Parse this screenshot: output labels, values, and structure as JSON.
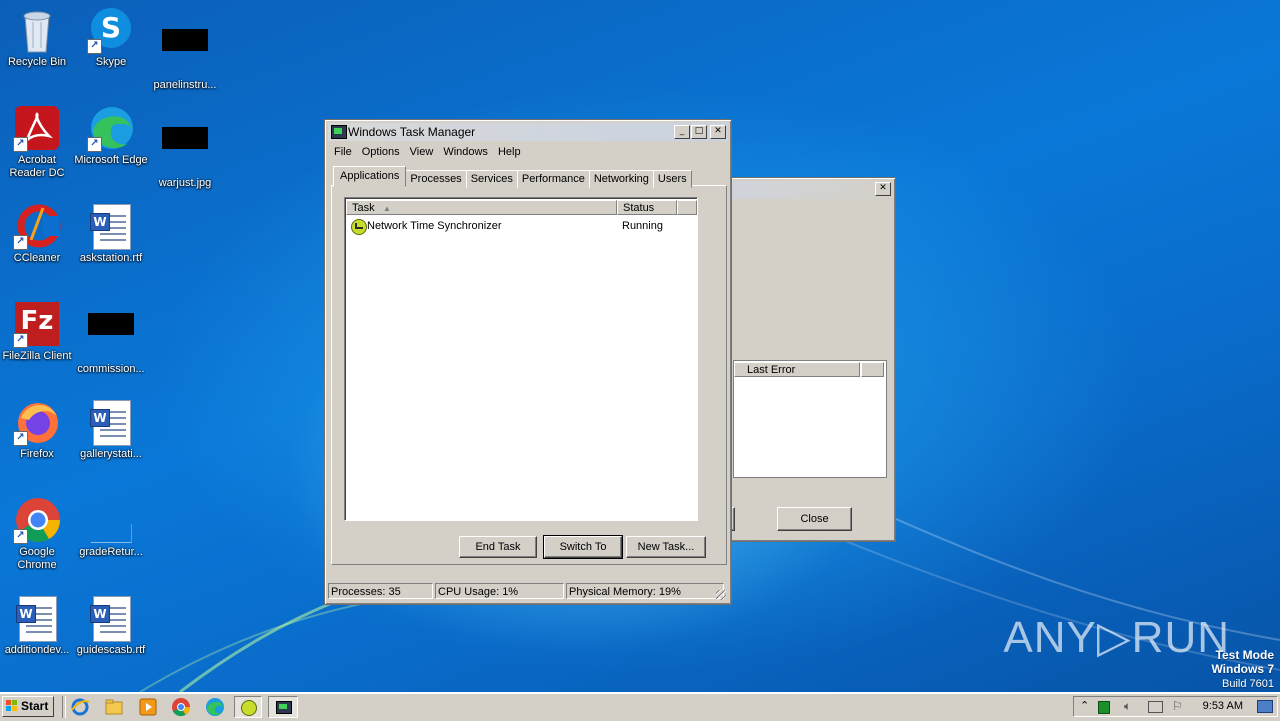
{
  "desktop": {
    "icons": [
      {
        "label": "Recycle Bin"
      },
      {
        "label": "Skype"
      },
      {
        "label": "panelinstru..."
      },
      {
        "label": "Acrobat Reader DC"
      },
      {
        "label": "Microsoft Edge"
      },
      {
        "label": "warjust.jpg"
      },
      {
        "label": "CCleaner"
      },
      {
        "label": "askstation.rtf"
      },
      {
        "label": "FileZilla Client"
      },
      {
        "label": "commission..."
      },
      {
        "label": "Firefox"
      },
      {
        "label": "gallerystati..."
      },
      {
        "label": "Google Chrome"
      },
      {
        "label": "gradeRetur..."
      },
      {
        "label": "additiondev..."
      },
      {
        "label": "guidescasb.rtf"
      }
    ],
    "watermark": {
      "brand": "ANY▷RUN",
      "mode": "Test Mode",
      "os": "Windows 7",
      "build": "Build 7601"
    }
  },
  "back_window": {
    "column_header": "Last Error",
    "close_label": "Close",
    "close_x": "✕"
  },
  "task_manager": {
    "title": "Windows Task Manager",
    "caption": {
      "minimize": "_",
      "maximize": "□",
      "close": "✕"
    },
    "menu": [
      "File",
      "Options",
      "View",
      "Windows",
      "Help"
    ],
    "tabs": [
      "Applications",
      "Processes",
      "Services",
      "Performance",
      "Networking",
      "Users"
    ],
    "active_tab": "Applications",
    "columns": {
      "task": "Task",
      "status": "Status"
    },
    "rows": [
      {
        "task": "Network Time Synchronizer",
        "status": "Running"
      }
    ],
    "buttons": {
      "end_task": "End Task",
      "switch_to": "Switch To",
      "new_task": "New Task..."
    },
    "status": {
      "processes": "Processes: 35",
      "cpu": "CPU Usage: 1%",
      "memory": "Physical Memory: 19%"
    }
  },
  "taskbar": {
    "start_label": "Start",
    "clock": "9:53 AM"
  }
}
